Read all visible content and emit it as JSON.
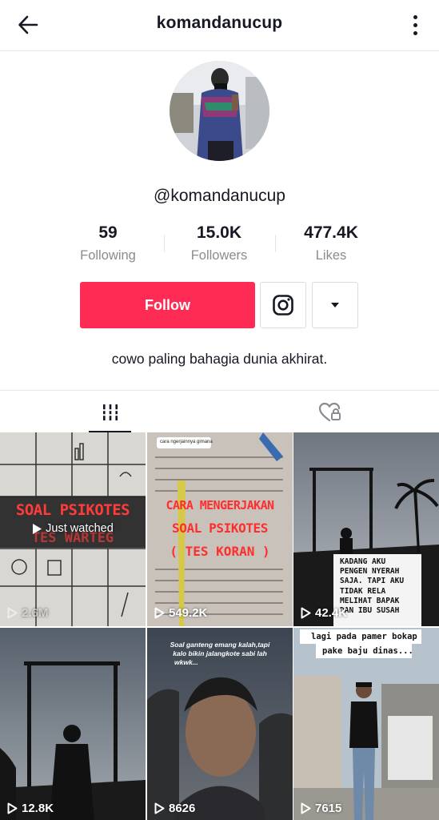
{
  "header": {
    "title": "komandanucup",
    "back_icon": "arrow-left-icon",
    "more_icon": "vertical-dots-icon"
  },
  "profile": {
    "handle": "@komandanucup",
    "bio": "cowo paling bahagia dunia akhirat."
  },
  "stats": [
    {
      "value": "59",
      "label": "Following"
    },
    {
      "value": "15.0K",
      "label": "Followers"
    },
    {
      "value": "477.4K",
      "label": "Likes"
    }
  ],
  "actions": {
    "follow_label": "Follow",
    "instagram_icon": "instagram-icon",
    "dropdown_icon": "caret-down-icon"
  },
  "tabs": [
    {
      "icon": "videos-grid-icon",
      "active": true
    },
    {
      "icon": "liked-heart-icon",
      "active": false
    }
  ],
  "colors": {
    "accent": "#fe2c55",
    "text": "#161823",
    "muted": "#8a8b91"
  },
  "videos": [
    {
      "views": "2.6M",
      "overlay": "Just watched",
      "caption_lines": [
        "SOAL PSIKOTES",
        "TES WARTEG"
      ]
    },
    {
      "views": "549.2K",
      "caption_lines": [
        "CARA MENGERJAKAN",
        "SOAL PSIKOTES",
        "( TES KORAN )"
      ],
      "tag": "cara ngerjainnya gimana"
    },
    {
      "views": "42.4K",
      "caption_lines": [
        "KADANG AKU",
        "PENGEN NYERAH",
        "SAJA. TAPI AKU",
        "TIDAK RELA",
        "MELIHAT BAPAK",
        "DAN IBU SUSAH"
      ]
    },
    {
      "views": "12.8K"
    },
    {
      "views": "8626",
      "caption_lines": [
        "Soal ganteng emang kalah,tapi",
        "kalo bikin jalangkote sabi lah",
        "wkwk..."
      ]
    },
    {
      "views": "7615",
      "caption_lines": [
        "lagi pada pamer bokap",
        "pake baju dinas..."
      ]
    }
  ]
}
